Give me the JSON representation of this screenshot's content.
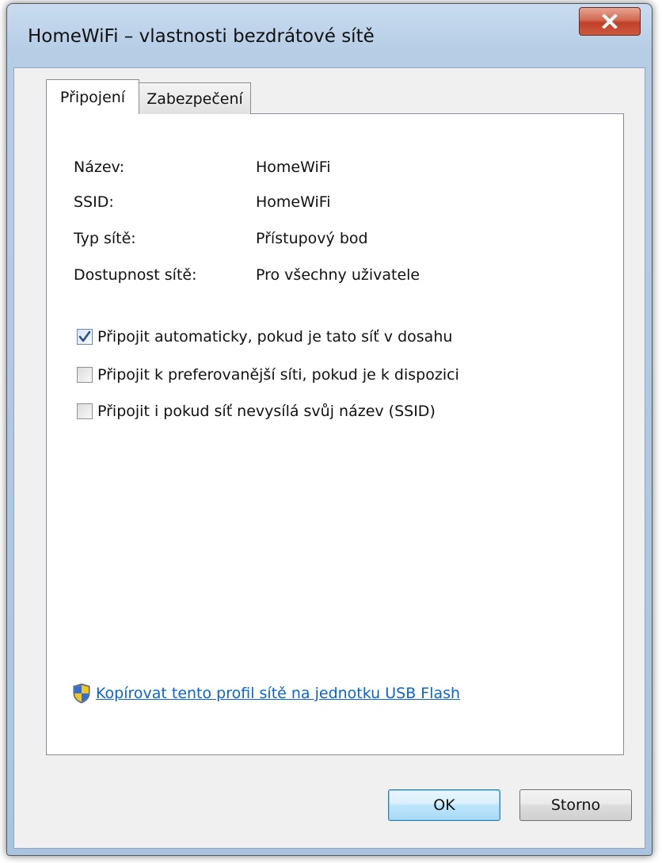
{
  "window": {
    "title": "HomeWiFi – vlastnosti bezdrátové sítě",
    "close_icon": "close-icon"
  },
  "tabs": [
    {
      "label": "Připojení",
      "active": true
    },
    {
      "label": "Zabezpečení",
      "active": false
    }
  ],
  "info": [
    {
      "label": "Název:",
      "value": "HomeWiFi"
    },
    {
      "label": "SSID:",
      "value": "HomeWiFi"
    },
    {
      "label": "Typ sítě:",
      "value": "Přístupový bod"
    },
    {
      "label": "Dostupnost sítě:",
      "value": "Pro všechny uživatele"
    }
  ],
  "options": [
    {
      "label": "Připojit automaticky, pokud je tato síť v dosahu",
      "checked": true
    },
    {
      "label": "Připojit k preferovanější síti, pokud je k dispozici",
      "checked": false
    },
    {
      "label": "Připojit i pokud síť nevysílá svůj název (SSID)",
      "checked": false
    }
  ],
  "usb_link": {
    "label": "Kopírovat tento profil sítě na jednotku USB Flash",
    "icon": "uac-shield-icon"
  },
  "buttons": {
    "ok": "OK",
    "cancel": "Storno"
  },
  "colors": {
    "link": "#0a66cc",
    "close_button": "#c0402a",
    "frame": "#b6cde6"
  }
}
